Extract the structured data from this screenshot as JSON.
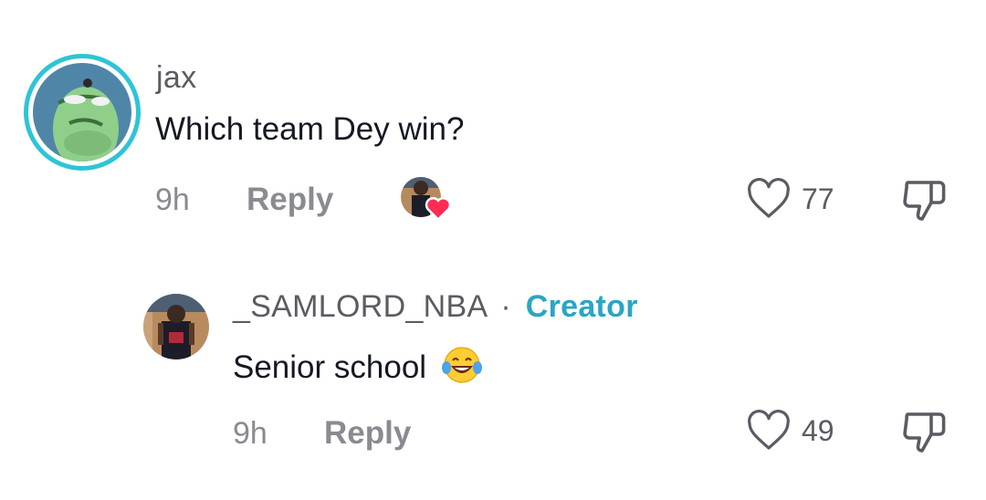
{
  "comments": [
    {
      "username": "jax",
      "text": "Which team Dey win?",
      "time": "9h",
      "reply_label": "Reply",
      "likes": "77"
    },
    {
      "username": "_SAMLORD_NBA",
      "separator": "·",
      "badge": "Creator",
      "text": "Senior school",
      "emoji": "😂",
      "time": "9h",
      "reply_label": "Reply",
      "likes": "49"
    }
  ],
  "colors": {
    "accent": "#2ba5c4",
    "ring": "#2ec4d6",
    "heart": "#fe2c55",
    "muted": "#8a8b91"
  }
}
